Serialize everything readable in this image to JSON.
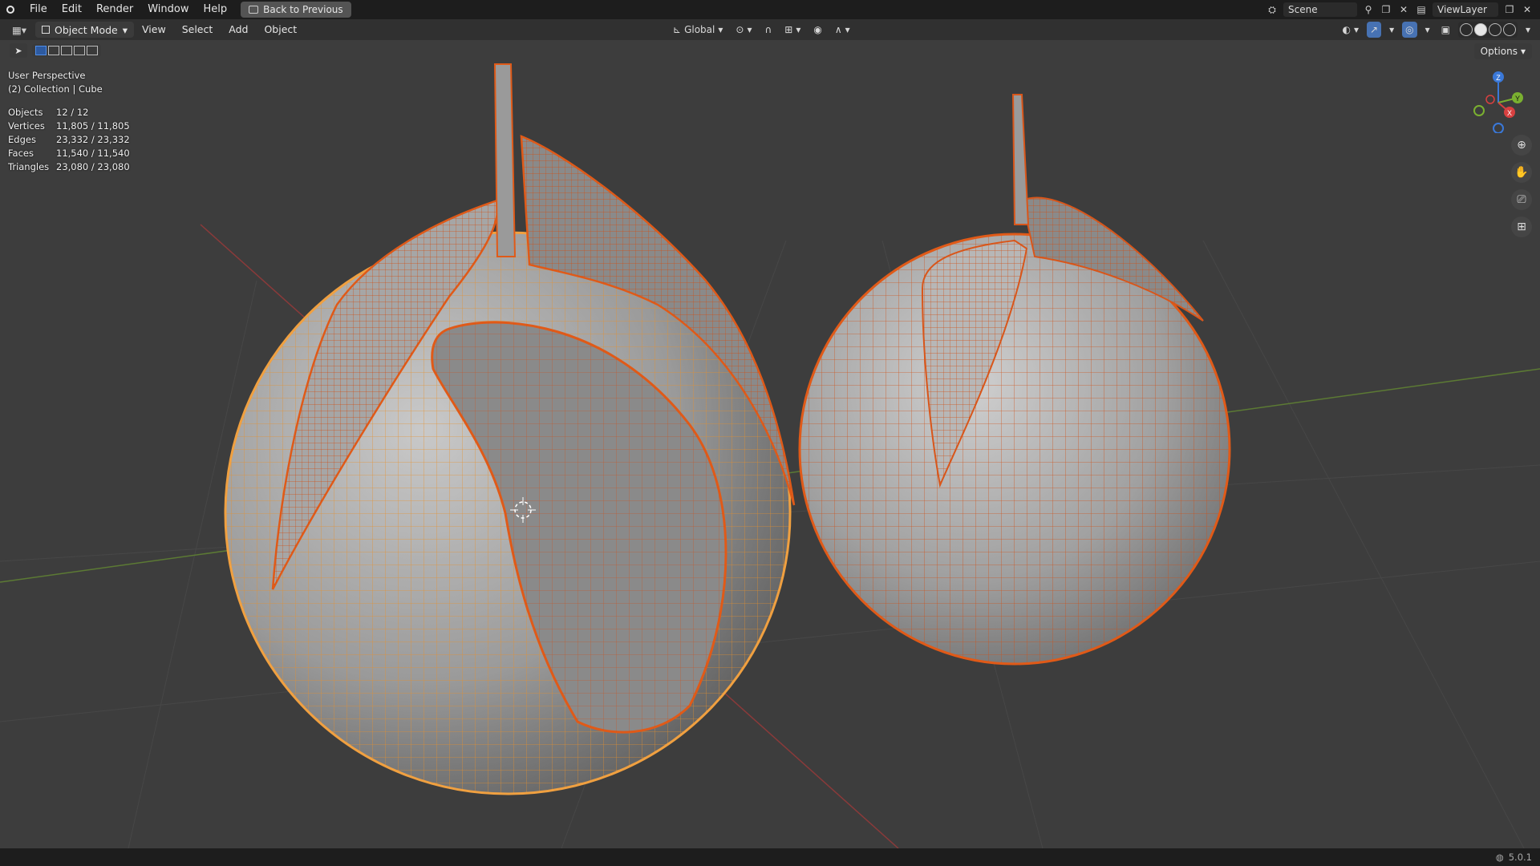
{
  "menubar": {
    "items": [
      "File",
      "Edit",
      "Render",
      "Window",
      "Help"
    ],
    "back_button": "Back to Previous",
    "scene": "Scene",
    "view_layer": "ViewLayer"
  },
  "header": {
    "mode": "Object Mode",
    "menus": [
      "View",
      "Select",
      "Add",
      "Object"
    ],
    "orientation": "Global",
    "options": "Options"
  },
  "viewport": {
    "view_name": "User Perspective",
    "collection": "(2) Collection | Cube",
    "stats": [
      {
        "label": "Objects",
        "value": "12 / 12"
      },
      {
        "label": "Vertices",
        "value": "11,805 / 11,805"
      },
      {
        "label": "Edges",
        "value": "23,332 / 23,332"
      },
      {
        "label": "Faces",
        "value": "11,540 / 11,540"
      },
      {
        "label": "Triangles",
        "value": "23,080 / 23,080"
      }
    ],
    "gizmo_axes": {
      "z": "Z",
      "y": "Y",
      "x": "X"
    },
    "colors": {
      "background": "#3d3d3d",
      "wire_selected": "#e8601a",
      "wire_active": "#f0a040",
      "axis_x": "#b04040",
      "axis_y": "#6a9a30"
    }
  },
  "statusbar": {
    "version": "5.0.1"
  }
}
